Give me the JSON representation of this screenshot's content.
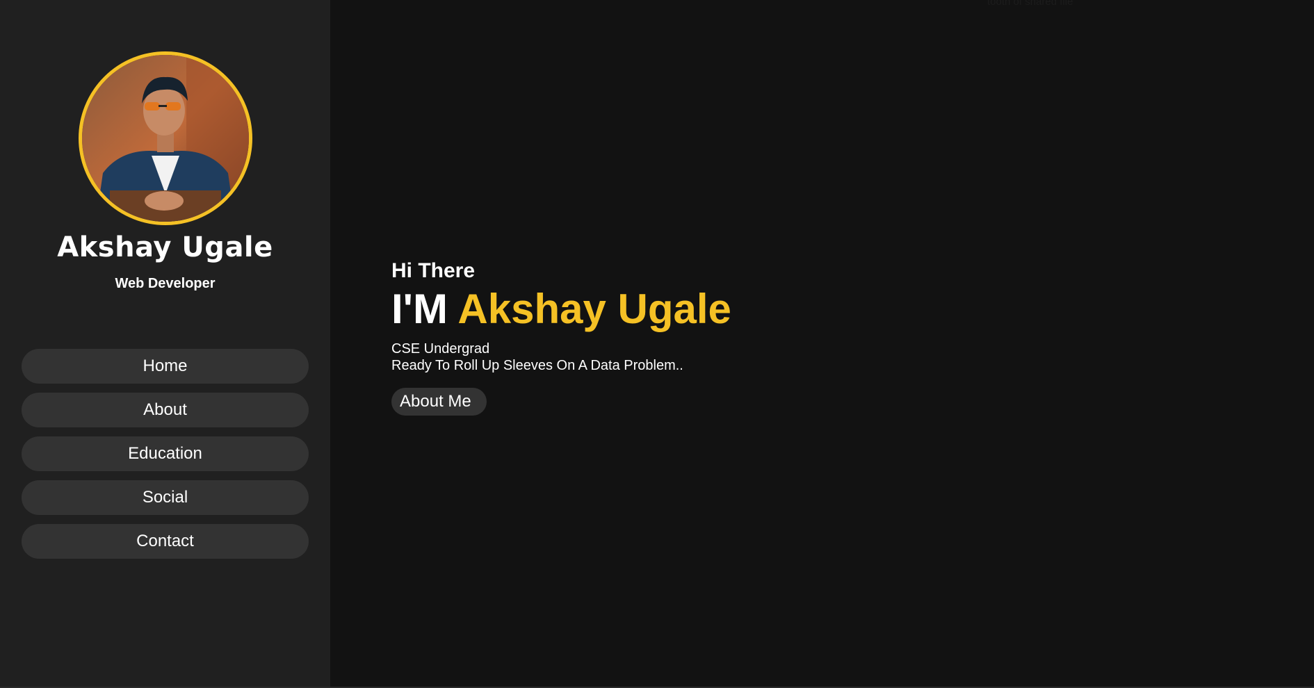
{
  "sidebar": {
    "profile": {
      "name": "Akshay Ugale",
      "role": "Web Developer"
    },
    "nav": [
      {
        "label": "Home"
      },
      {
        "label": "About"
      },
      {
        "label": "Education"
      },
      {
        "label": "Social"
      },
      {
        "label": "Contact"
      }
    ]
  },
  "hero": {
    "greeting": "Hi There",
    "prefix": "I'M",
    "name": "Akshay Ugale",
    "line1": "CSE Undergrad",
    "line2": "Ready To Roll Up Sleeves On A Data Problem..",
    "cta_label": "About Me"
  },
  "faint_text": "tooth of shared file",
  "colors": {
    "accent": "#f5c125",
    "sidebar_bg": "#202020",
    "page_bg": "#121212",
    "pill_bg": "#333333"
  }
}
